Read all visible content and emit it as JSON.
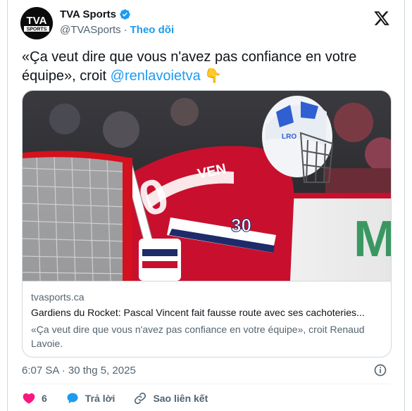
{
  "tweet": {
    "author": {
      "display_name": "TVA Sports",
      "handle": "@TVASports",
      "separator": "·",
      "follow_label": "Theo dõi",
      "avatar_line1": "TVA",
      "avatar_line2": "SPORTS",
      "verified": true
    },
    "text": {
      "part1": "«Ça veut dire que vous n'avez pas confiance en votre équipe», croit ",
      "mention": "@renlavoietva",
      "emoji": "👇"
    },
    "link_card": {
      "domain": "tvasports.ca",
      "title": "Gardiens du Rocket: Pascal Vincent fait fausse route avec ses cachoteries...",
      "description": "«Ça veut dire que vous n'avez pas confiance en votre équipe», croit Renaud Lavoie.",
      "photo_jersey_number": "30",
      "photo_jersey_name": "VEN",
      "photo_mask_letters": "LRO"
    },
    "timestamp": "6:07 SA · 30 thg 5, 2025",
    "actions": {
      "like_count": "6",
      "reply_label": "Trả lời",
      "copy_link_label": "Sao liên kết"
    }
  },
  "colors": {
    "accent": "#1d9bf0",
    "like": "#f91880",
    "text_secondary": "#536471",
    "jersey_red": "#c8102e"
  },
  "icons": [
    "verified-badge-icon",
    "x-logo-icon",
    "info-icon",
    "heart-icon",
    "reply-bubble-icon",
    "link-icon",
    "pointing-down-emoji"
  ]
}
